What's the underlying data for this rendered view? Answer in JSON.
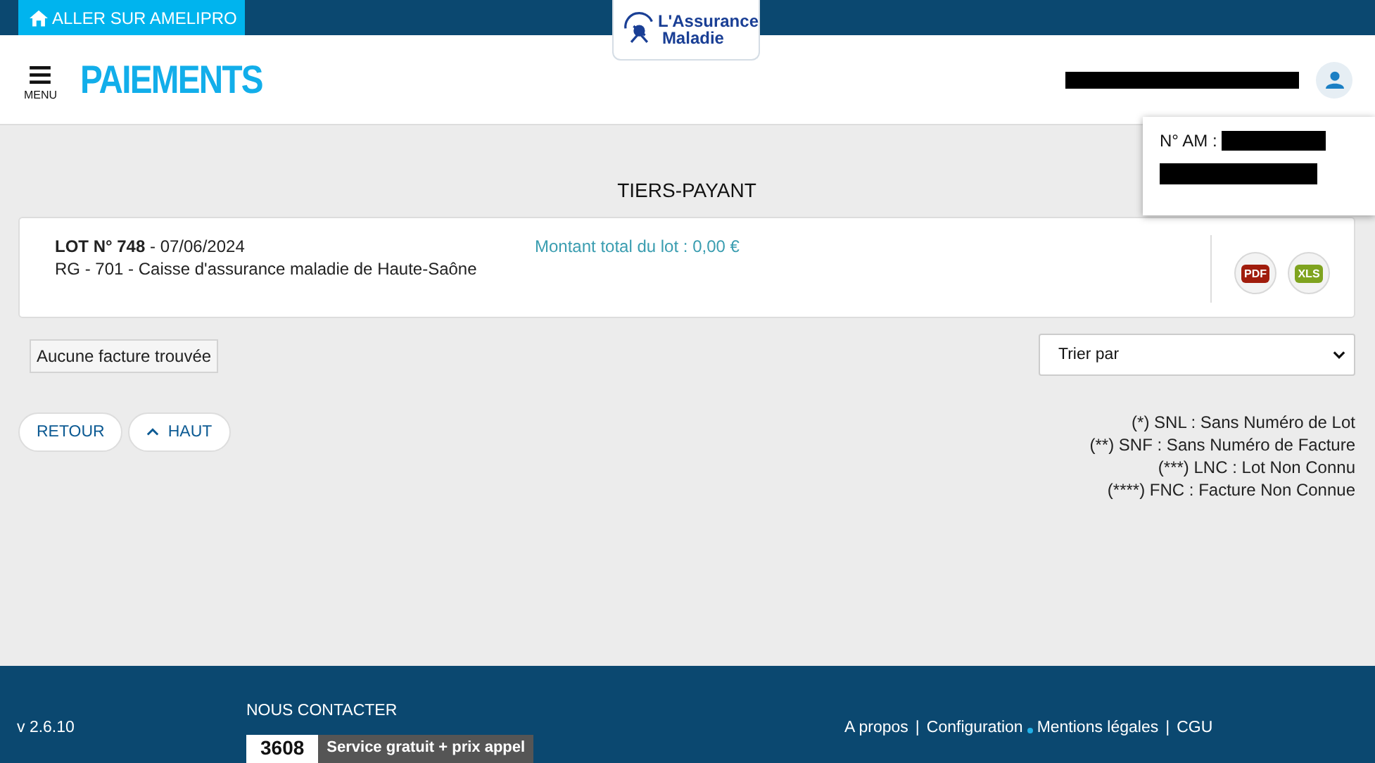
{
  "topbar": {
    "home_link": "ALLER SUR AMELIPRO",
    "logo": {
      "line1": "L'Assurance",
      "line2": "Maladie"
    }
  },
  "header": {
    "menu_label": "MENU",
    "title": "PAIEMENTS",
    "user_redacted": true
  },
  "user_popover": {
    "label": "N° AM :"
  },
  "page_title": "TIERS-PAYANT",
  "lot": {
    "number_label": "LOT N° 748",
    "date": " - 07/06/2024",
    "organism": "RG - 701 - Caisse d'assurance maladie de Haute-Saône",
    "total": "Montant total du lot : 0,00 €",
    "exports": [
      {
        "label": "PDF",
        "color": "#a01c0c"
      },
      {
        "label": "XLS",
        "color": "#7fa31f"
      }
    ]
  },
  "no_result": "Aucune facture trouvée",
  "sort": {
    "value": "Trier par"
  },
  "buttons": [
    {
      "label": "RETOUR",
      "kind": "plain"
    },
    {
      "label": "HAUT",
      "kind": "up"
    }
  ],
  "legend": [
    "(*) SNL : Sans Numéro de Lot",
    "(**) SNF : Sans Numéro de Facture",
    "(***) LNC : Lot Non Connu",
    "(****) FNC : Facture Non Connue"
  ],
  "footer": {
    "version": "v 2.6.10",
    "contact_title": "NOUS CONTACTER",
    "phone": "3608",
    "phone_note": "Service gratuit + prix appel",
    "links": [
      {
        "kind": "link",
        "text": "A propos"
      },
      {
        "kind": "separator",
        "text": "|"
      },
      {
        "kind": "link",
        "text": "Configuration"
      },
      {
        "kind": "dot"
      },
      {
        "kind": "link",
        "text": "Mentions légales"
      },
      {
        "kind": "separator",
        "text": "|"
      },
      {
        "kind": "link",
        "text": "CGU"
      }
    ]
  }
}
